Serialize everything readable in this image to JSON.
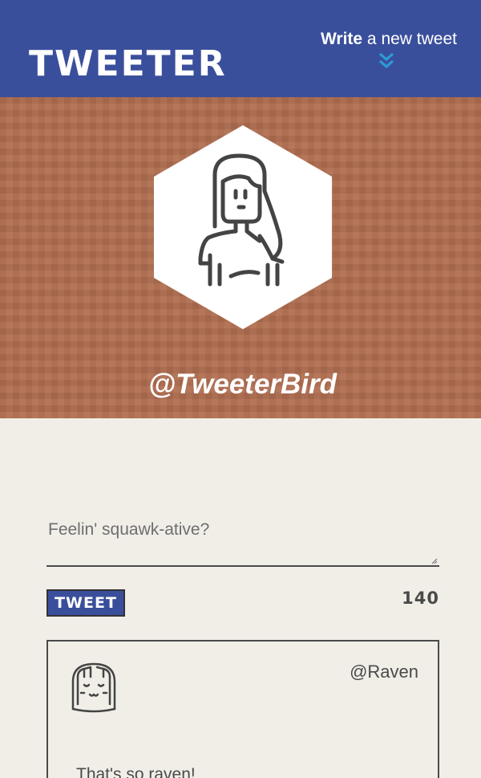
{
  "header": {
    "logo": "TWEETER",
    "compose_link_bold": "Write",
    "compose_link_rest": " a new tweet",
    "compose_icon": "double-chevron-down-icon"
  },
  "profile": {
    "handle": "@TweeterBird",
    "avatar_icon": "girl-avatar-icon",
    "banner_color": "#b06d4f"
  },
  "composer": {
    "placeholder": "Feelin' squawk-ative?",
    "value": "",
    "submit_label": "TWEET",
    "char_count": "140"
  },
  "tweets": [
    {
      "handle": "@Raven",
      "avatar_icon": "smiling-girl-avatar-icon",
      "text": "That's so raven!"
    }
  ],
  "colors": {
    "navbar": "#3a4f9c",
    "accent": "#2a9fd6",
    "background": "#f1eee8",
    "text": "#4a4a4a"
  }
}
